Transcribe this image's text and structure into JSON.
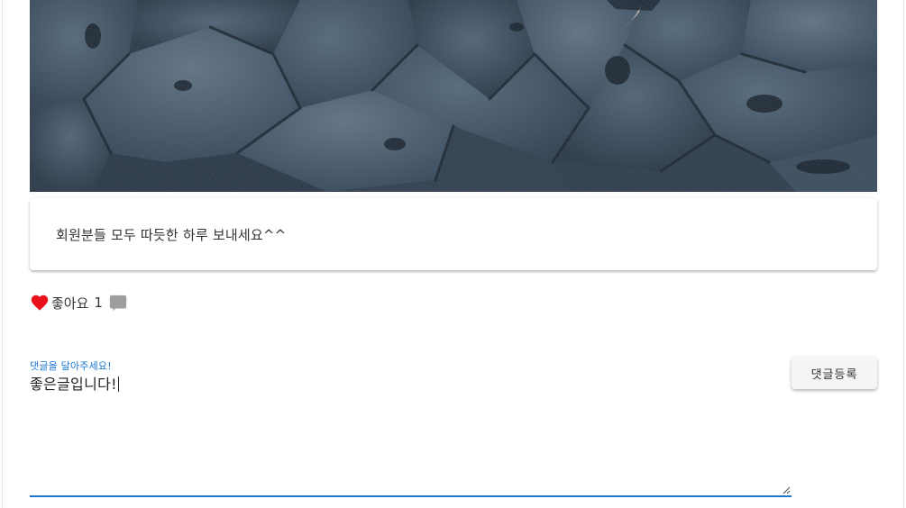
{
  "post": {
    "content": "회원분들 모두 따듯한 하루 보내세요^^",
    "image_icon": "rocky-shore-photo"
  },
  "actions": {
    "like_label": "좋아요",
    "like_count": "1",
    "like_icon": "heart-icon",
    "comment_icon": "comment-icon"
  },
  "comment_form": {
    "label": "댓글을 달아주세요!",
    "value": "좋은글입니다!",
    "submit_label": "댓글등록"
  },
  "colors": {
    "accent": "#1976d2",
    "like": "#e8101a",
    "comment_icon": "#9e9e9e"
  }
}
